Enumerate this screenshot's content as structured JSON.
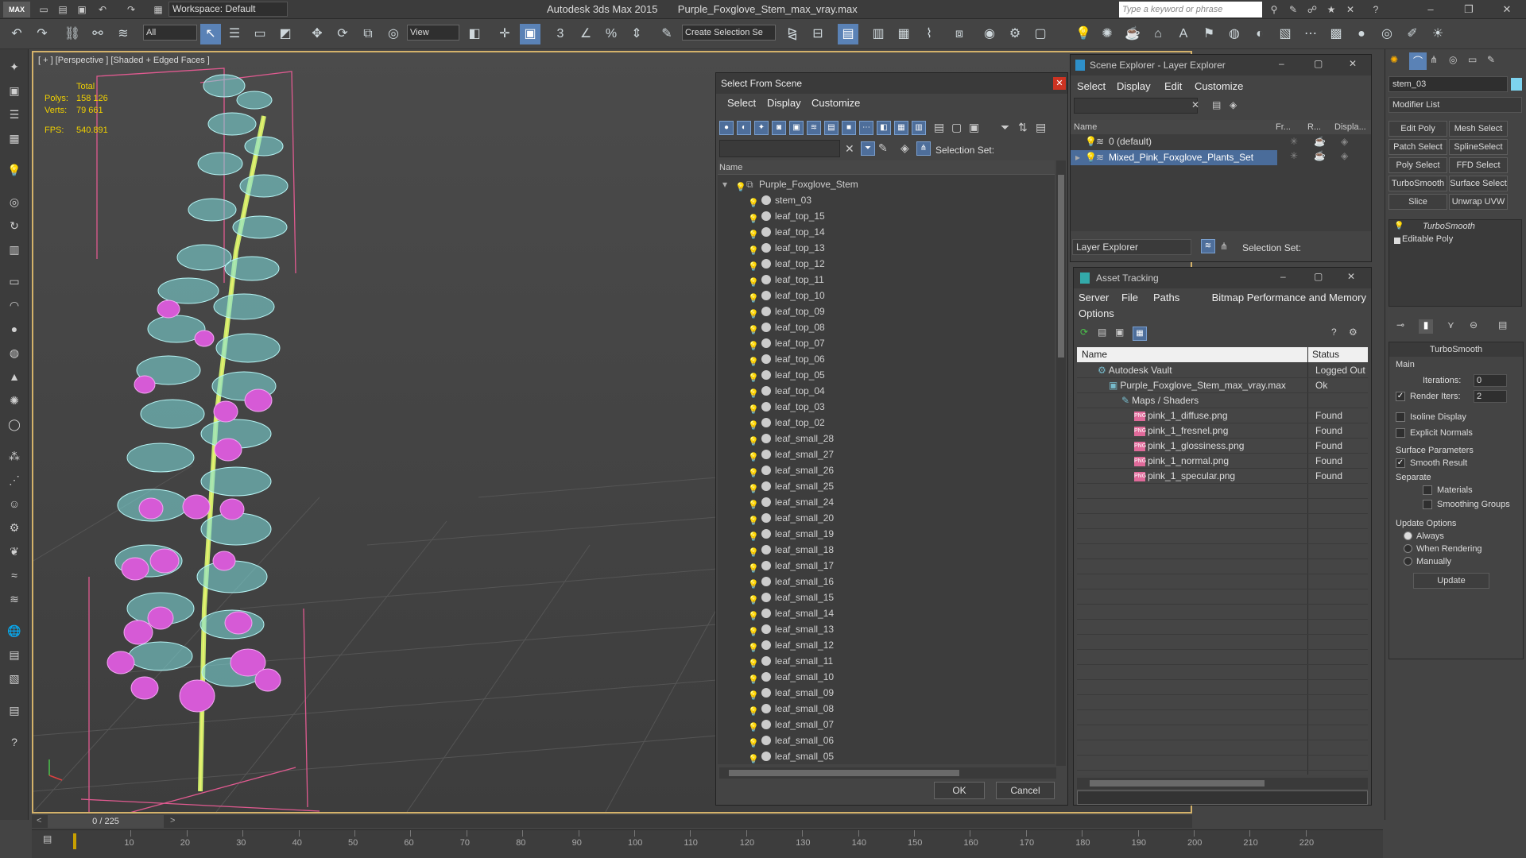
{
  "titlebar": {
    "logo": "MAX",
    "workspace": "Workspace: Default",
    "app_name": "Autodesk 3ds Max 2015",
    "file_name": "Purple_Foxglove_Stem_max_vray.max",
    "search_placeholder": "Type a keyword or phrase"
  },
  "toolbar": {
    "filter_value": "All",
    "refcoord_value": "View",
    "selection_set_placeholder": "Create Selection Se"
  },
  "viewport": {
    "label": "[ + ] [Perspective ] [Shaded + Edged Faces ]",
    "stats_total": "Total",
    "polys_label": "Polys:",
    "polys_value": "158 126",
    "verts_label": "Verts:",
    "verts_value": "79 661",
    "fps_label": "FPS:",
    "fps_value": "540.891"
  },
  "select_from_scene": {
    "title": "Select From Scene",
    "menu": [
      "Select",
      "Display",
      "Customize"
    ],
    "selection_set_label": "Selection Set:",
    "column_name": "Name",
    "parent": "Purple_Foxglove_Stem",
    "items": [
      "stem_03",
      "leaf_top_15",
      "leaf_top_14",
      "leaf_top_13",
      "leaf_top_12",
      "leaf_top_11",
      "leaf_top_10",
      "leaf_top_09",
      "leaf_top_08",
      "leaf_top_07",
      "leaf_top_06",
      "leaf_top_05",
      "leaf_top_04",
      "leaf_top_03",
      "leaf_top_02",
      "leaf_small_28",
      "leaf_small_27",
      "leaf_small_26",
      "leaf_small_25",
      "leaf_small_24",
      "leaf_small_20",
      "leaf_small_19",
      "leaf_small_18",
      "leaf_small_17",
      "leaf_small_16",
      "leaf_small_15",
      "leaf_small_14",
      "leaf_small_13",
      "leaf_small_12",
      "leaf_small_11",
      "leaf_small_10",
      "leaf_small_09",
      "leaf_small_08",
      "leaf_small_07",
      "leaf_small_06",
      "leaf_small_05"
    ],
    "ok": "OK",
    "cancel": "Cancel"
  },
  "scene_explorer": {
    "title": "Scene Explorer - Layer Explorer",
    "menu": [
      "Select",
      "Display",
      "Edit",
      "Customize"
    ],
    "col_name": "Name",
    "col_fr": "Fr...",
    "col_r": "R...",
    "col_disp": "Displa...",
    "layers": [
      "0 (default)",
      "Mixed_Pink_Foxglove_Plants_Set"
    ],
    "footer_dropdown": "Layer Explorer",
    "footer_selection_set": "Selection Set:"
  },
  "asset_tracking": {
    "title": "Asset Tracking",
    "menu": [
      "Server",
      "File",
      "Paths",
      "Bitmap Performance and Memory",
      "Options"
    ],
    "col_name": "Name",
    "col_status": "Status",
    "rows": [
      {
        "name": "Autodesk Vault",
        "status": "Logged Out"
      },
      {
        "name": "Purple_Foxglove_Stem_max_vray.max",
        "status": "Ok"
      },
      {
        "name": "Maps / Shaders",
        "status": ""
      },
      {
        "name": "pink_1_diffuse.png",
        "status": "Found"
      },
      {
        "name": "pink_1_fresnel.png",
        "status": "Found"
      },
      {
        "name": "pink_1_glossiness.png",
        "status": "Found"
      },
      {
        "name": "pink_1_normal.png",
        "status": "Found"
      },
      {
        "name": "pink_1_specular.png",
        "status": "Found"
      }
    ]
  },
  "command_panel": {
    "object_name": "stem_03",
    "modifier_list": "Modifier List",
    "buttons": [
      "Edit Poly",
      "Mesh Select",
      "Patch Select",
      "SplineSelect",
      "Poly Select",
      "FFD Select",
      "TurboSmooth",
      "Surface Select",
      "Slice",
      "Unwrap UVW"
    ],
    "stack": [
      "TurboSmooth",
      "Editable Poly"
    ],
    "rollout_title": "TurboSmooth",
    "main_label": "Main",
    "iterations_label": "Iterations:",
    "iterations_value": "0",
    "render_iters_label": "Render Iters:",
    "render_iters_value": "2",
    "isoline": "Isoline Display",
    "explicit_normals": "Explicit Normals",
    "surface_params": "Surface Parameters",
    "smooth_result": "Smooth Result",
    "separate": "Separate",
    "materials": "Materials",
    "smoothing_groups": "Smoothing Groups",
    "update_options": "Update Options",
    "always": "Always",
    "when_rendering": "When Rendering",
    "manually": "Manually",
    "update": "Update"
  },
  "timeline": {
    "frame_display": "0 / 225",
    "ticks": [
      "10",
      "20",
      "30",
      "40",
      "50",
      "60",
      "70",
      "80",
      "90",
      "100",
      "110",
      "120",
      "130",
      "140",
      "150",
      "160",
      "170",
      "180",
      "190",
      "200",
      "210",
      "220"
    ]
  },
  "colors": {
    "accent": "#5a82b6",
    "viewport_border": "#d4b26a",
    "wire": "#7fe0e0",
    "flower": "#d65ad6"
  }
}
